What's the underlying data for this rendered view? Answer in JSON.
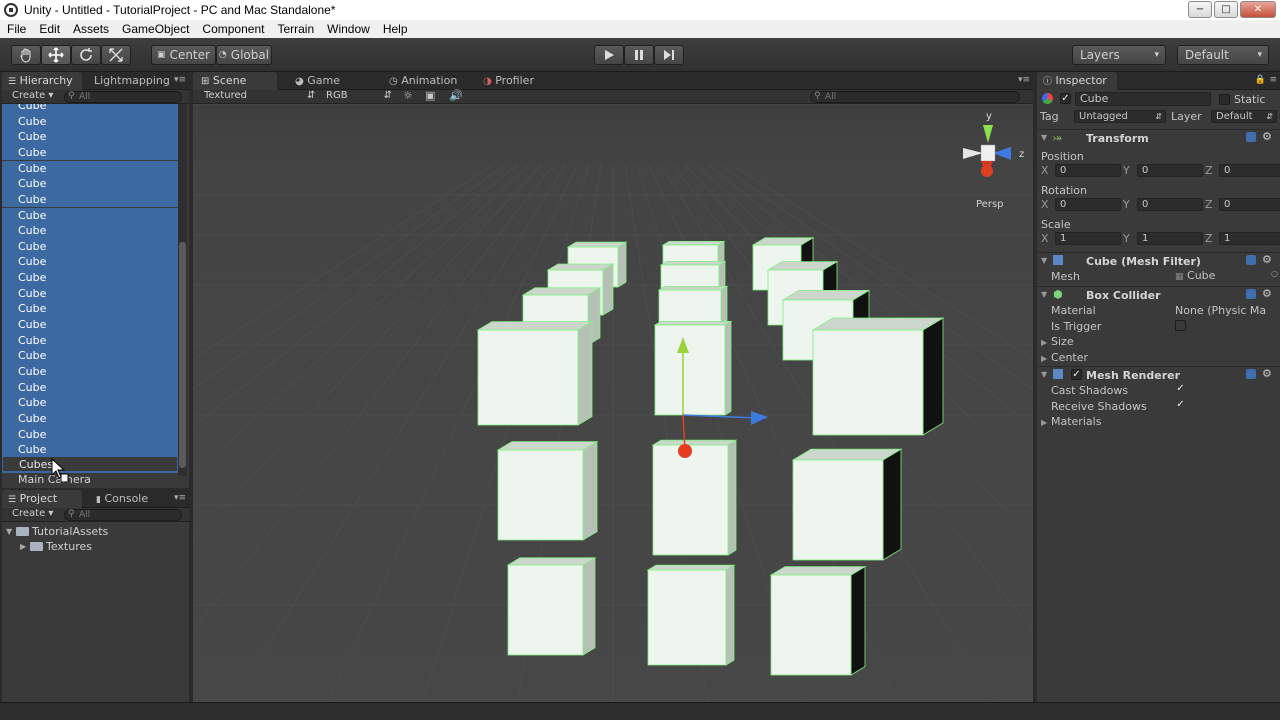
{
  "window": {
    "title": "Unity - Untitled - TutorialProject - PC and Mac Standalone*",
    "min_label": "−",
    "max_label": "□",
    "close_label": "✕"
  },
  "menu": [
    "File",
    "Edit",
    "Assets",
    "GameObject",
    "Component",
    "Terrain",
    "Window",
    "Help"
  ],
  "toolbar": {
    "pivot_label": "Center",
    "space_label": "Global",
    "layers_label": "Layers",
    "layout_label": "Default"
  },
  "hierarchy": {
    "tab_label": "Hierarchy",
    "tab2_label": "Lightmapping",
    "create_label": "Create",
    "search_placeholder": "All",
    "partial_item": "Cube",
    "items": [
      "Cube",
      "Cube",
      "Cube",
      "Cube",
      "Cube",
      "Cube",
      "Cube",
      "Cube",
      "Cube",
      "Cube",
      "Cube",
      "Cube",
      "Cube",
      "Cube",
      "Cube",
      "Cube",
      "Cube",
      "Cube",
      "Cube",
      "Cube",
      "Cube",
      "Cube",
      "Cube"
    ],
    "renaming_item": "Cubes",
    "camera_item": "Main Camera"
  },
  "project": {
    "tab_label": "Project",
    "tab2_label": "Console",
    "create_label": "Create",
    "search_placeholder": "All",
    "folders": [
      {
        "name": "TutorialAssets",
        "expanded": true,
        "depth": 0
      },
      {
        "name": "Textures",
        "expanded": false,
        "depth": 1
      }
    ]
  },
  "scene": {
    "tabs": [
      {
        "label": "Scene",
        "icon": "grid-icon",
        "active": true
      },
      {
        "label": "Game",
        "icon": "pacman-icon",
        "active": false
      },
      {
        "label": "Animation",
        "icon": "animation-icon",
        "active": false
      },
      {
        "label": "Profiler",
        "icon": "profiler-icon",
        "active": false
      }
    ],
    "draw_mode": "Textured",
    "render_mode": "RGB",
    "search_placeholder": "All",
    "gizmo_y": "y",
    "gizmo_z": "z",
    "gizmo_label": "Persp"
  },
  "inspector": {
    "tab_label": "Inspector",
    "object_name": "Cube",
    "active": true,
    "static_label": "Static",
    "tag_label": "Tag",
    "tag_value": "Untagged",
    "layer_label": "Layer",
    "layer_value": "Default",
    "transform": {
      "title": "Transform",
      "position_label": "Position",
      "rotation_label": "Rotation",
      "scale_label": "Scale",
      "axis_x": "X",
      "axis_y": "Y",
      "axis_z": "Z",
      "position": [
        "0",
        "0",
        "0"
      ],
      "rotation": [
        "0",
        "0",
        "0"
      ],
      "scale": [
        "1",
        "1",
        "1"
      ]
    },
    "mesh_filter": {
      "title": "Cube (Mesh Filter)",
      "mesh_label": "Mesh",
      "mesh_value": "Cube"
    },
    "box_collider": {
      "title": "Box Collider",
      "material_label": "Material",
      "material_value": "None (Physic Ma",
      "trigger_label": "Is Trigger",
      "size_label": "Size",
      "center_label": "Center"
    },
    "mesh_renderer": {
      "title": "Mesh Renderer",
      "cast_label": "Cast Shadows",
      "receive_label": "Receive Shadows",
      "materials_label": "Materials"
    }
  },
  "colors": {
    "selection": "#3d69a3",
    "cube_face": "#eef5ee",
    "wire": "#7ef07e"
  }
}
